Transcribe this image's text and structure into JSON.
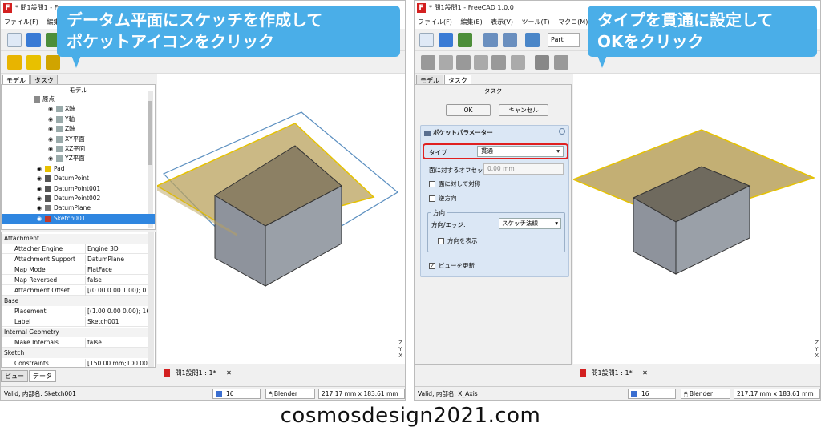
{
  "left": {
    "title": "* 問1設問1 - Fre",
    "menus": [
      "ファイル(F)",
      "編集(E)"
    ],
    "callout": [
      "データム平面にスケッチを作成して",
      "ポケットアイコンをクリック"
    ],
    "tabs": [
      "モデル",
      "タスク"
    ],
    "panel_title": "モデル",
    "tree": [
      {
        "label": "原点",
        "icon": "origin-icon"
      },
      {
        "label": "X軸",
        "icon": "axis-icon"
      },
      {
        "label": "Y軸",
        "icon": "axis-icon"
      },
      {
        "label": "Z軸",
        "icon": "axis-icon"
      },
      {
        "label": "XY平面",
        "icon": "plane-icon"
      },
      {
        "label": "XZ平面",
        "icon": "plane-icon"
      },
      {
        "label": "YZ平面",
        "icon": "plane-icon"
      },
      {
        "label": "Pad",
        "icon": "pad-icon"
      },
      {
        "label": "DatumPoint",
        "icon": "point-icon"
      },
      {
        "label": "DatumPoint001",
        "icon": "point-icon"
      },
      {
        "label": "DatumPoint002",
        "icon": "point-icon"
      },
      {
        "label": "DatumPlane",
        "icon": "datum-plane-icon"
      },
      {
        "label": "Sketch001",
        "icon": "sketch-icon"
      }
    ],
    "properties": [
      {
        "group": "Attachment"
      },
      {
        "k": "Attacher Engine",
        "v": "Engine 3D"
      },
      {
        "k": "Attachment Support",
        "v": "DatumPlane"
      },
      {
        "k": "Map Mode",
        "v": "FlatFace"
      },
      {
        "k": "Map Reversed",
        "v": "false"
      },
      {
        "k": "Attachment Offset",
        "v": "[(0.00 0.00 1.00); 0..."
      },
      {
        "group": "Base"
      },
      {
        "k": "Placement",
        "v": "[(1.00 0.00 0.00); 16..."
      },
      {
        "k": "Label",
        "v": "Sketch001"
      },
      {
        "group": "Internal Geometry"
      },
      {
        "k": "Make Internals",
        "v": "false"
      },
      {
        "group": "Sketch"
      },
      {
        "k": "Constraints",
        "v": "[150.00 mm;100.00..."
      }
    ],
    "bottom_tabs": [
      "ビュー",
      "データ"
    ],
    "doc_tab": "問1設問1 : 1*",
    "status_text": "Valid, 内部名: Sketch001",
    "zoom": "16",
    "nav": "Blender",
    "dims": "217.17 mm x 183.61 mm"
  },
  "right": {
    "title": "* 問1設問1 - FreeCAD 1.0.0",
    "menus": [
      "ファイル(F)",
      "編集(E)",
      "表示(V)",
      "ツール(T)",
      "マクロ(M)",
      "ウ"
    ],
    "workbench": "Part",
    "callout": [
      "タイプを貫通に設定して",
      "OKをクリック"
    ],
    "tabs": [
      "モデル",
      "タスク"
    ],
    "panel_title": "タスク",
    "ok": "OK",
    "cancel": "キャンセル",
    "section_title": "ポケットパラメーター",
    "type_label": "タイプ",
    "type_value": "貫通",
    "offset_label": "面に対するオフセット",
    "offset_value": "0.00 mm",
    "symmetric": "面に対して対称",
    "reversed": "逆方向",
    "direction_group": "方向",
    "direction_label": "方向/エッジ:",
    "direction_value": "スケッチ法線",
    "show_direction": "方向を表示",
    "update_view": "ビューを更新",
    "doc_tab": "問1設問1 : 1*",
    "status_text": "Valid, 内部名: X_Axis",
    "zoom": "16",
    "nav": "Blender",
    "dims": "217.17 mm x 183.61 mm"
  },
  "footer": "cosmosdesign2021.com",
  "colors": {
    "callout": "#4aaee8",
    "highlight": "#e02020",
    "plane": "#b9a15c",
    "selection": "#2f86e0"
  }
}
